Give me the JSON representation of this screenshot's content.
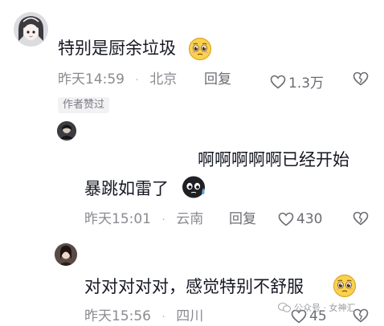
{
  "comments": [
    {
      "text": "特别是厨余垃圾",
      "emoji": "pleading-face-emoji",
      "time": "昨天14:59",
      "location": "北京",
      "reply_label": "回复",
      "likes": "1.3万",
      "author_badge": "作者赞过"
    },
    {
      "text_line1": "啊啊啊啊啊已经开始",
      "text_line2": "暴跳如雷了",
      "emoji": "sweat-blob-emoji",
      "time": "昨天15:01",
      "location": "云南",
      "reply_label": "回复",
      "likes": "430"
    },
    {
      "text": "对对对对对，感觉特别不舒服",
      "emoji": "pleading-face-emoji",
      "time": "昨天15:56",
      "location": "四川",
      "reply_label": "回复",
      "likes": "45"
    }
  ],
  "separator": "·",
  "watermark": {
    "text": "公众号 · 女神汇"
  },
  "colors": {
    "text": "#161823",
    "meta": "#8a8b91",
    "badge_bg": "#f2f2f4"
  }
}
